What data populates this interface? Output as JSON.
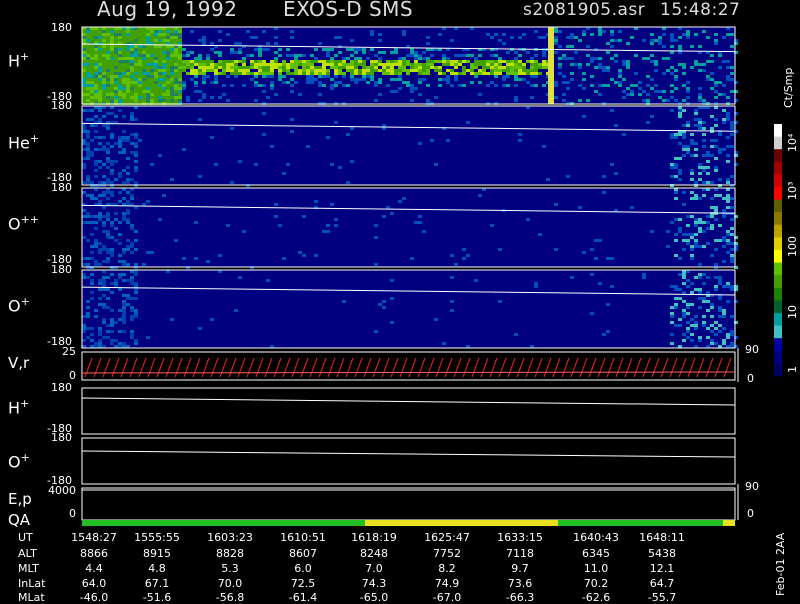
{
  "header": {
    "date": "Aug 19, 1992",
    "instrument": "EXOS-D SMS",
    "file": "s2081905.asr",
    "time": "15:48:27"
  },
  "panels": [
    {
      "label": "H",
      "sup": "+",
      "top": "180",
      "bottom": "-180"
    },
    {
      "label": "He",
      "sup": "+",
      "top": "180",
      "bottom": "-180"
    },
    {
      "label": "O",
      "sup": "++",
      "top": "180",
      "bottom": "-180"
    },
    {
      "label": "O",
      "sup": "+",
      "top": "180",
      "bottom": "-180"
    }
  ],
  "vr_panel": {
    "label": "V,r",
    "left_top": "25",
    "left_zero": "0",
    "right_top": "90",
    "right_zero": "0"
  },
  "line_panels": [
    {
      "label": "H",
      "sup": "+",
      "top": "180",
      "bottom": "-180"
    },
    {
      "label": "O",
      "sup": "+",
      "top": "180",
      "bottom": "-180"
    }
  ],
  "ep_panel": {
    "label": "E,p",
    "left_tick": "4000",
    "right_top": "90",
    "right_zero": "0"
  },
  "qa_panel": {
    "label": "QA",
    "left_tick": "0"
  },
  "colorbar": {
    "title": "Ct/Smp",
    "ticks": [
      "10⁴",
      "10³",
      "100",
      "10",
      "1"
    ],
    "colors": [
      "#ffffff",
      "#d0d0d0",
      "#6b0000",
      "#a00000",
      "#d00000",
      "#ff0000",
      "#606000",
      "#8a7a00",
      "#c0a000",
      "#e0d000",
      "#ffff00",
      "#60c000",
      "#40a000",
      "#208000",
      "#006030",
      "#00a0a0",
      "#40c0c0",
      "#0000a0",
      "#000080",
      "#000060"
    ]
  },
  "qa_colors": {
    "good": "#22c022",
    "caution": "#e8e020"
  },
  "table": {
    "rows": [
      "UT",
      "ALT",
      "MLT",
      "InLat",
      "MLat"
    ],
    "columns": [
      [
        "1548:27",
        "8866",
        "4.4",
        "64.0",
        "-46.0"
      ],
      [
        "1555:55",
        "8915",
        "4.8",
        "67.1",
        "-51.6"
      ],
      [
        "1603:23",
        "8828",
        "5.3",
        "70.0",
        "-56.8"
      ],
      [
        "1610:51",
        "8607",
        "6.0",
        "72.5",
        "-61.4"
      ],
      [
        "1618:19",
        "8248",
        "7.0",
        "74.3",
        "-65.0"
      ],
      [
        "1625:47",
        "7752",
        "8.2",
        "74.9",
        "-67.0"
      ],
      [
        "1633:15",
        "7118",
        "9.7",
        "73.6",
        "-66.3"
      ],
      [
        "1640:43",
        "6345",
        "11.0",
        "70.2",
        "-62.6"
      ],
      [
        "1648:11",
        "5438",
        "12.1",
        "64.7",
        "-55.7"
      ]
    ]
  },
  "footer_note": "Feb-01 2AA",
  "chart_data": {
    "type": "heatmap",
    "title": "Aug 19, 1992   EXOS-D SMS",
    "x_ticks": [
      "1548:27",
      "1555:55",
      "1603:23",
      "1610:51",
      "1618:19",
      "1625:47",
      "1633:15",
      "1640:43",
      "1648:11"
    ],
    "y_range": [
      -180,
      180
    ],
    "species": [
      "H+",
      "He+",
      "O++",
      "O+"
    ],
    "colorbar_unit": "Ct/Smp",
    "colorbar_scale": "log",
    "colorbar_range": [
      1,
      10000
    ]
  }
}
